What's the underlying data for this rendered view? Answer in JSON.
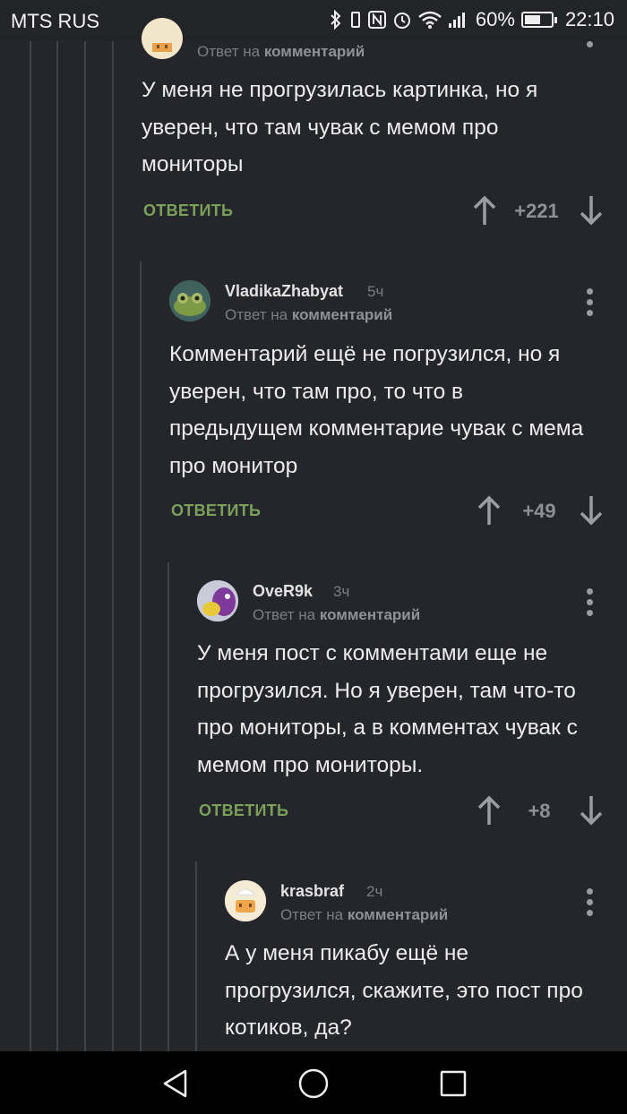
{
  "status_bar": {
    "carrier": "MTS RUS",
    "battery": "60%",
    "battery_level": 0.6,
    "time": "22:10"
  },
  "reply_prefix": "Ответ на",
  "reply_target": "комментарий",
  "reply_label": "ОТВЕТИТЬ",
  "comments": [
    {
      "author": "",
      "time": "",
      "text": "У меня не прогрузилась картинка, но я уверен, что там чувак с мемом про мониторы",
      "score": "+221"
    },
    {
      "author": "VladikaZhabyat",
      "time": "5ч",
      "text": "Комментарий ещё не погрузился, но я уверен, что там про, то что в предыдущем комментарие чувак с мема про монитор",
      "score": "+49"
    },
    {
      "author": "OveR9k",
      "time": "3ч",
      "text": "У меня пост с комментами еще не прогрузился. Но я уверен, там что-то про мониторы, а в комментах чувак с мемом про мониторы.",
      "score": "+8"
    },
    {
      "author": "krasbraf",
      "time": "2ч",
      "text": "А у меня пикабу ещё не прогрузился, скажите, это пост про котиков, да?",
      "score": ""
    }
  ]
}
